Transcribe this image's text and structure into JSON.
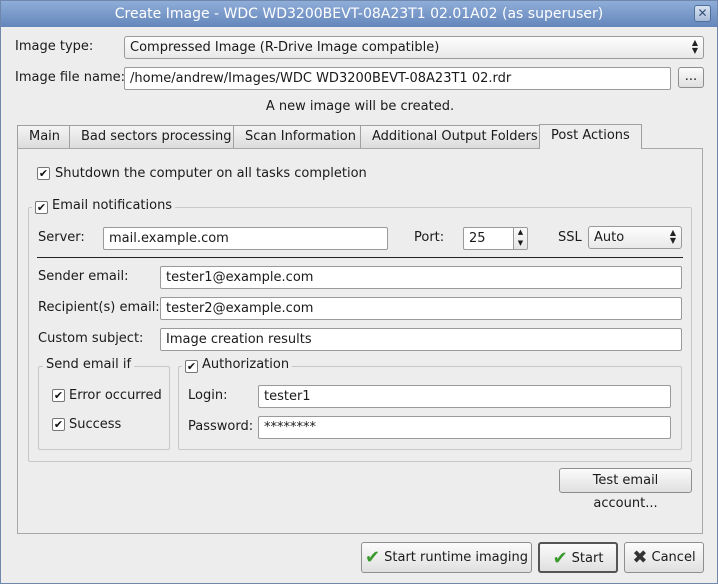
{
  "window": {
    "title": "Create Image - WDC WD3200BEVT-08A23T1 02.01A02 (as superuser)",
    "close_glyph": "✕"
  },
  "image_type": {
    "label": "Image type:",
    "value": "Compressed Image (R-Drive Image compatible)"
  },
  "image_file": {
    "label": "Image file name:",
    "value": "/home/andrew/Images/WDC WD3200BEVT-08A23T1 02.rdr",
    "browse_label": "..."
  },
  "info_message": "A new image will be created.",
  "tabs": [
    {
      "label": "Main"
    },
    {
      "label": "Bad sectors processing"
    },
    {
      "label": "Scan Information"
    },
    {
      "label": "Additional Output Folders"
    },
    {
      "label": "Post Actions"
    }
  ],
  "post_actions": {
    "shutdown": {
      "label": "Shutdown the computer on all tasks completion",
      "checked": true
    },
    "email": {
      "label": "Email notifications",
      "checked": true,
      "server_label": "Server:",
      "server": "mail.example.com",
      "port_label": "Port:",
      "port": "25",
      "ssl_label": "SSL",
      "ssl": "Auto",
      "sender_label": "Sender email:",
      "sender": "tester1@example.com",
      "recipient_label": "Recipient(s) email:",
      "recipient": "tester2@example.com",
      "subject_label": "Custom subject:",
      "subject": "Image creation results",
      "send_if": {
        "label": "Send email if",
        "error": {
          "label": "Error occurred",
          "checked": true
        },
        "success": {
          "label": "Success",
          "checked": true
        }
      },
      "auth": {
        "label": "Authorization",
        "checked": true,
        "login_label": "Login:",
        "login": "tester1",
        "password_label": "Password:",
        "password": "********"
      },
      "test_button": "Test email account..."
    }
  },
  "buttons": {
    "runtime": "Start runtime imaging",
    "start": "Start",
    "cancel": "Cancel"
  }
}
